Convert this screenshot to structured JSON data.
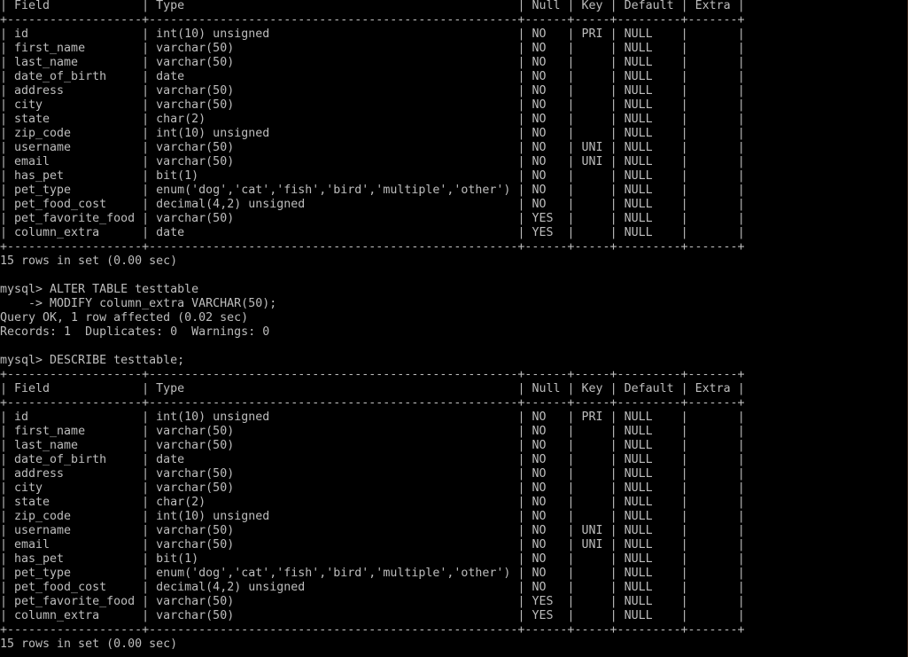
{
  "columns": [
    "Field",
    "Type",
    "Null",
    "Key",
    "Default",
    "Extra"
  ],
  "prompt": "mysql>",
  "continuation": "    ->",
  "table1": {
    "rows": [
      [
        "id",
        "int(10) unsigned",
        "NO",
        "PRI",
        "NULL",
        ""
      ],
      [
        "first_name",
        "varchar(50)",
        "NO",
        "",
        "NULL",
        ""
      ],
      [
        "last_name",
        "varchar(50)",
        "NO",
        "",
        "NULL",
        ""
      ],
      [
        "date_of_birth",
        "date",
        "NO",
        "",
        "NULL",
        ""
      ],
      [
        "address",
        "varchar(50)",
        "NO",
        "",
        "NULL",
        ""
      ],
      [
        "city",
        "varchar(50)",
        "NO",
        "",
        "NULL",
        ""
      ],
      [
        "state",
        "char(2)",
        "NO",
        "",
        "NULL",
        ""
      ],
      [
        "zip_code",
        "int(10) unsigned",
        "NO",
        "",
        "NULL",
        ""
      ],
      [
        "username",
        "varchar(50)",
        "NO",
        "UNI",
        "NULL",
        ""
      ],
      [
        "email",
        "varchar(50)",
        "NO",
        "UNI",
        "NULL",
        ""
      ],
      [
        "has_pet",
        "bit(1)",
        "NO",
        "",
        "NULL",
        ""
      ],
      [
        "pet_type",
        "enum('dog','cat','fish','bird','multiple','other')",
        "NO",
        "",
        "NULL",
        ""
      ],
      [
        "pet_food_cost",
        "decimal(4,2) unsigned",
        "NO",
        "",
        "NULL",
        ""
      ],
      [
        "pet_favorite_food",
        "varchar(50)",
        "YES",
        "",
        "NULL",
        ""
      ],
      [
        "column_extra",
        "date",
        "YES",
        "",
        "NULL",
        ""
      ]
    ],
    "summary": "15 rows in set (0.00 sec)"
  },
  "alter": {
    "command_line1": "ALTER TABLE testtable",
    "command_line2": "MODIFY column_extra VARCHAR(50);",
    "result1": "Query OK, 1 row affected (0.02 sec)",
    "result2": "Records: 1  Duplicates: 0  Warnings: 0"
  },
  "describe": {
    "command": "DESCRIBE testtable;"
  },
  "table2": {
    "rows": [
      [
        "id",
        "int(10) unsigned",
        "NO",
        "PRI",
        "NULL",
        ""
      ],
      [
        "first_name",
        "varchar(50)",
        "NO",
        "",
        "NULL",
        ""
      ],
      [
        "last_name",
        "varchar(50)",
        "NO",
        "",
        "NULL",
        ""
      ],
      [
        "date_of_birth",
        "date",
        "NO",
        "",
        "NULL",
        ""
      ],
      [
        "address",
        "varchar(50)",
        "NO",
        "",
        "NULL",
        ""
      ],
      [
        "city",
        "varchar(50)",
        "NO",
        "",
        "NULL",
        ""
      ],
      [
        "state",
        "char(2)",
        "NO",
        "",
        "NULL",
        ""
      ],
      [
        "zip_code",
        "int(10) unsigned",
        "NO",
        "",
        "NULL",
        ""
      ],
      [
        "username",
        "varchar(50)",
        "NO",
        "UNI",
        "NULL",
        ""
      ],
      [
        "email",
        "varchar(50)",
        "NO",
        "UNI",
        "NULL",
        ""
      ],
      [
        "has_pet",
        "bit(1)",
        "NO",
        "",
        "NULL",
        ""
      ],
      [
        "pet_type",
        "enum('dog','cat','fish','bird','multiple','other')",
        "NO",
        "",
        "NULL",
        ""
      ],
      [
        "pet_food_cost",
        "decimal(4,2) unsigned",
        "NO",
        "",
        "NULL",
        ""
      ],
      [
        "pet_favorite_food",
        "varchar(50)",
        "YES",
        "",
        "NULL",
        ""
      ],
      [
        "column_extra",
        "varchar(50)",
        "YES",
        "",
        "NULL",
        ""
      ]
    ],
    "summary": "15 rows in set (0.00 sec)"
  }
}
